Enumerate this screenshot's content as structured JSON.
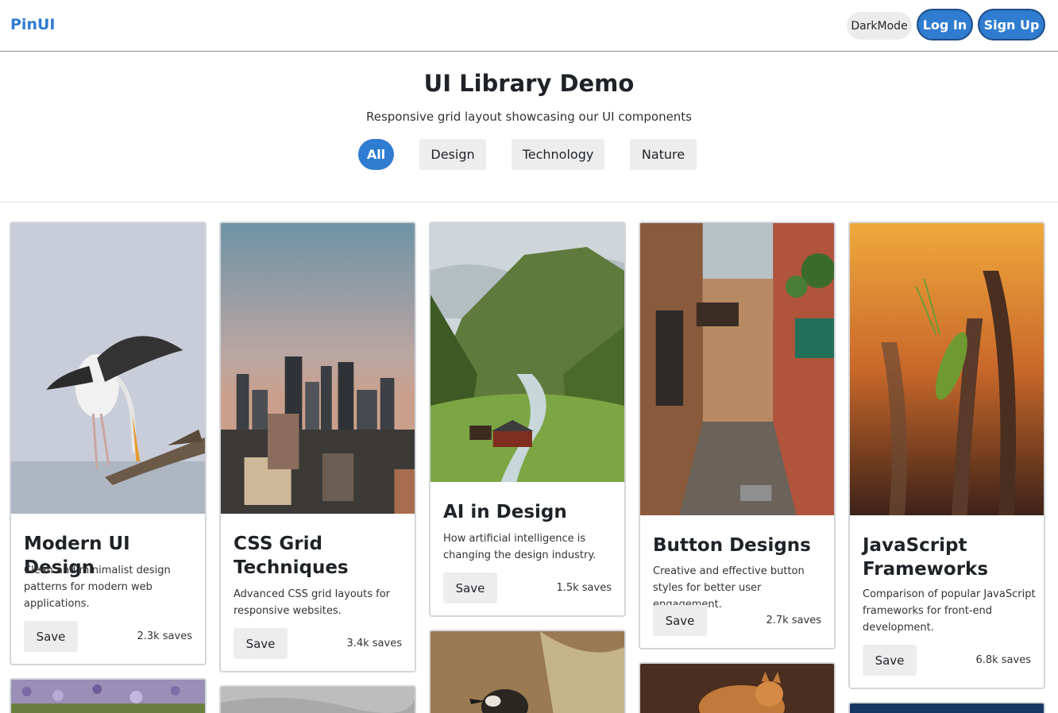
{
  "header": {
    "brand": "PinUI",
    "darkmode_label": "DarkMode",
    "login_label": "Log In",
    "signup_label": "Sign Up"
  },
  "hero": {
    "title": "UI Library Demo",
    "subtitle": "Responsive grid layout showcasing our UI components",
    "filters": [
      "All",
      "Design",
      "Technology",
      "Nature"
    ],
    "active_filter": "All"
  },
  "cards": [
    {
      "title": "Modern UI Design",
      "description": "Clean and minimalist design patterns for modern web applications.",
      "save_label": "Save",
      "saves": "2.3k saves",
      "image": "stork-on-branch"
    },
    {
      "title": "CSS Grid Techniques",
      "description": "Advanced CSS grid layouts for responsive websites.",
      "save_label": "Save",
      "saves": "3.4k saves",
      "image": "city-skyline-sunset"
    },
    {
      "title": "AI in Design",
      "description": "How artificial intelligence is changing the design industry.",
      "save_label": "Save",
      "saves": "1.5k saves",
      "image": "green-valley-houses"
    },
    {
      "title": "Button Designs",
      "description": "Creative and effective button styles for better user engagement.",
      "save_label": "Save",
      "saves": "2.7k saves",
      "image": "narrow-alley-stairs"
    },
    {
      "title": "JavaScript Frameworks",
      "description": "Comparison of popular JavaScript frameworks for front-end development.",
      "save_label": "Save",
      "saves": "6.8k saves",
      "image": "grasshopper-on-wheat"
    }
  ],
  "colors": {
    "accent": "#2f7cd1",
    "accent_border": "#1e4f86",
    "button_gray": "#ededed",
    "card_border": "#d3d6da"
  }
}
